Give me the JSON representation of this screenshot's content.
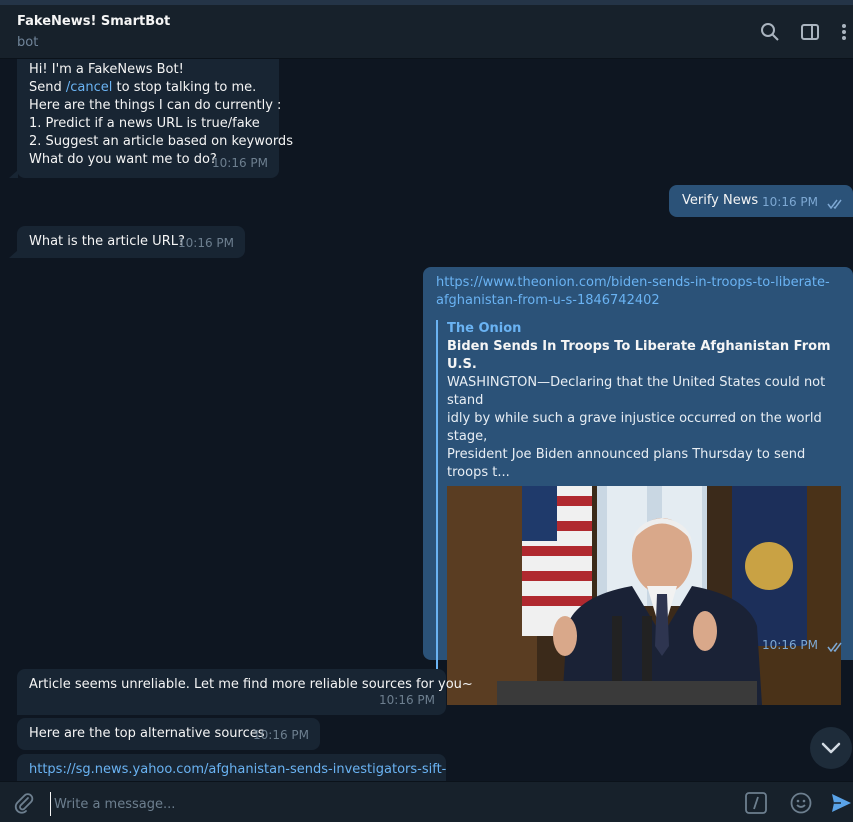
{
  "header": {
    "title": "FakeNews! SmartBot",
    "subtitle": "bot",
    "icons": [
      "search-icon",
      "sidebar-toggle-icon",
      "more-vertical-icon"
    ]
  },
  "messages": {
    "m1": {
      "lines": [
        "Hi! I'm a FakeNews Bot!",
        "Send ",
        "/cancel",
        " to stop talking to me.",
        "Here are the things I can do currently :",
        "1. Predict if a news URL is true/fake",
        "2. Suggest an article based on keywords",
        "What do you want me to do?"
      ],
      "time": "10:16 PM"
    },
    "m2": {
      "text": "Verify News",
      "time": "10:16 PM"
    },
    "m3": {
      "text": "What is the article URL?",
      "time": "10:16 PM"
    },
    "m4": {
      "url_line1": "https://www.theonion.com/biden-sends-in-troops-to-liberate-",
      "url_line2": "afghanistan-from-u-s-1846742402",
      "preview": {
        "site": "The Onion",
        "title": "Biden Sends In Troops To Liberate Afghanistan From U.S.",
        "desc_line1": "WASHINGTON—Declaring that the United States could not stand",
        "desc_line2": "idly by while such a grave injustice occurred on the world stage,",
        "desc_line3": "President Joe Biden announced plans Thursday to send troops t..."
      },
      "time": "10:16 PM"
    },
    "m5": {
      "text": "Article seems unreliable. Let me find more reliable sources for you~",
      "time": "10:16 PM"
    },
    "m6": {
      "text": "Here are the top alternative sources",
      "time": "10:16 PM"
    },
    "m7": {
      "url_partial": "https://sg.news.yahoo.com/afghanistan-sends-investigators-sift-"
    }
  },
  "composer": {
    "placeholder": "Write a message...",
    "icons": [
      "attach-icon",
      "commands-icon",
      "emoji-icon",
      "send-icon"
    ]
  },
  "colors": {
    "background": "#0e1621",
    "incoming_bubble": "#182533",
    "outgoing_bubble": "#2b5278",
    "link": "#6ab3f3"
  }
}
